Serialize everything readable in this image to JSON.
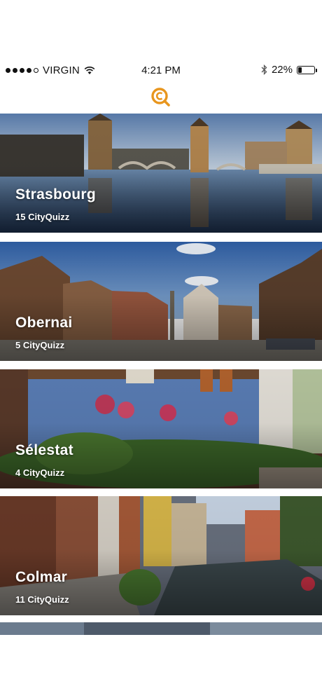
{
  "status_bar": {
    "carrier": "VIRGIN",
    "time": "4:21 PM",
    "battery": "22%",
    "signal_bars_filled": 4,
    "signal_bars_total": 5,
    "battery_level": 0.22
  },
  "header": {
    "logo_icon": "cityquizz-logo-icon",
    "accent": "#E8961E"
  },
  "cities": [
    {
      "name": "Strasbourg",
      "count": "15 CityQuizz"
    },
    {
      "name": "Obernai",
      "count": "5 CityQuizz"
    },
    {
      "name": "Sélestat",
      "count": "4 CityQuizz"
    },
    {
      "name": "Colmar",
      "count": "11 CityQuizz"
    }
  ]
}
